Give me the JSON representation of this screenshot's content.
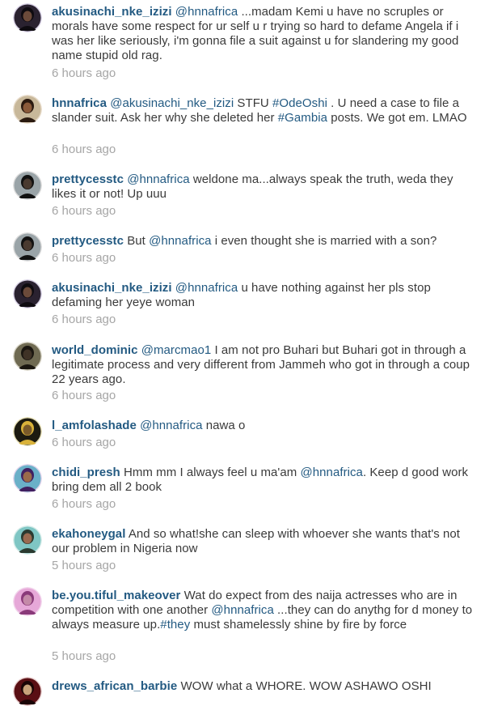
{
  "colors": {
    "link": "#235a82",
    "text": "#3a3a3a",
    "timestamp": "#a6a6a6",
    "background": "#ffffff"
  },
  "comments": [
    {
      "username": "akusinachi_nke_izizi",
      "segments": [
        {
          "type": "mention",
          "text": "@hnnafrica"
        },
        {
          "type": "text",
          "text": " ...madam Kemi u have no scruples or morals have some respect for ur self  u r trying so hard to defame Angela if i was her like seriously, i'm gonna file a suit against u for slandering my good name stupid old rag."
        }
      ],
      "time": "6 hours ago",
      "avatar": "avatar-dark-portrait-icon"
    },
    {
      "username": "hnnafrica",
      "segments": [
        {
          "type": "mention",
          "text": "@akusinachi_nke_izizi"
        },
        {
          "type": "text",
          "text": " STFU "
        },
        {
          "type": "hashtag",
          "text": "#OdeOshi"
        },
        {
          "type": "text",
          "text": " . U need a case to file a slander suit. Ask her why she deleted her "
        },
        {
          "type": "hashtag",
          "text": "#Gambia"
        },
        {
          "type": "text",
          "text": " posts. We got em. LMAO"
        }
      ],
      "time": "6 hours ago",
      "avatar": "avatar-woman-portrait-icon"
    },
    {
      "username": "prettycesstc",
      "segments": [
        {
          "type": "mention",
          "text": "@hnnafrica"
        },
        {
          "type": "text",
          "text": "  weldone ma...always speak the truth, weda they likes it or not! Up uuu"
        }
      ],
      "time": "6 hours ago",
      "avatar": "avatar-person-outdoor-icon"
    },
    {
      "username": "prettycesstc",
      "segments": [
        {
          "type": "text",
          "text": "But "
        },
        {
          "type": "mention",
          "text": "@hnnafrica"
        },
        {
          "type": "text",
          "text": "  i even thought she is married with a son?"
        }
      ],
      "time": "6 hours ago",
      "avatar": "avatar-person-outdoor-icon"
    },
    {
      "username": "akusinachi_nke_izizi",
      "segments": [
        {
          "type": "mention",
          "text": "@hnnafrica"
        },
        {
          "type": "text",
          "text": "  u have nothing against her pls stop defaming her yeye woman"
        }
      ],
      "time": "6 hours ago",
      "avatar": "avatar-dark-portrait-icon"
    },
    {
      "username": "world_dominic",
      "segments": [
        {
          "type": "mention",
          "text": "@marcmao1"
        },
        {
          "type": "text",
          "text": " I am not pro Buhari but Buhari got in through a legitimate process and very different from Jammeh who got in through a coup 22 years ago."
        }
      ],
      "time": "6 hours ago",
      "avatar": "avatar-man-portrait-icon"
    },
    {
      "username": "l_amfolashade",
      "segments": [
        {
          "type": "mention",
          "text": "@hnnafrica"
        },
        {
          "type": "text",
          "text": " nawa o"
        }
      ],
      "time": "6 hours ago",
      "avatar": "avatar-yellow-portrait-icon"
    },
    {
      "username": "chidi_presh",
      "segments": [
        {
          "type": "text",
          "text": "Hmm mm I always feel u ma'am "
        },
        {
          "type": "mention",
          "text": "@hnnafrica"
        },
        {
          "type": "text",
          "text": ". Keep d good work bring dem all 2 book"
        }
      ],
      "time": "6 hours ago",
      "avatar": "avatar-colorful-portrait-icon"
    },
    {
      "username": "ekahoneygal",
      "segments": [
        {
          "type": "text",
          "text": "And so what!she can sleep with whoever she wants that's not our problem in Nigeria now"
        }
      ],
      "time": "5 hours ago",
      "avatar": "avatar-teal-portrait-icon"
    },
    {
      "username": "be.you.tiful_makeover",
      "segments": [
        {
          "type": "text",
          "text": "Wat do expect from des naija actresses who are in competition with one another "
        },
        {
          "type": "mention",
          "text": "@hnnafrica"
        },
        {
          "type": "text",
          "text": " ...they can do anythg for d money to always  measure up."
        },
        {
          "type": "hashtag",
          "text": "#they"
        },
        {
          "type": "text",
          "text": " must shamelessly shine by fire by force"
        }
      ],
      "time": "5 hours ago",
      "avatar": "avatar-pink-portrait-icon"
    },
    {
      "username": "drews_african_barbie",
      "segments": [
        {
          "type": "text",
          "text": "WOW what a WHORE. WOW ASHAWO OSHI"
        }
      ],
      "time": "",
      "avatar": "avatar-magazine-cover-icon"
    }
  ]
}
